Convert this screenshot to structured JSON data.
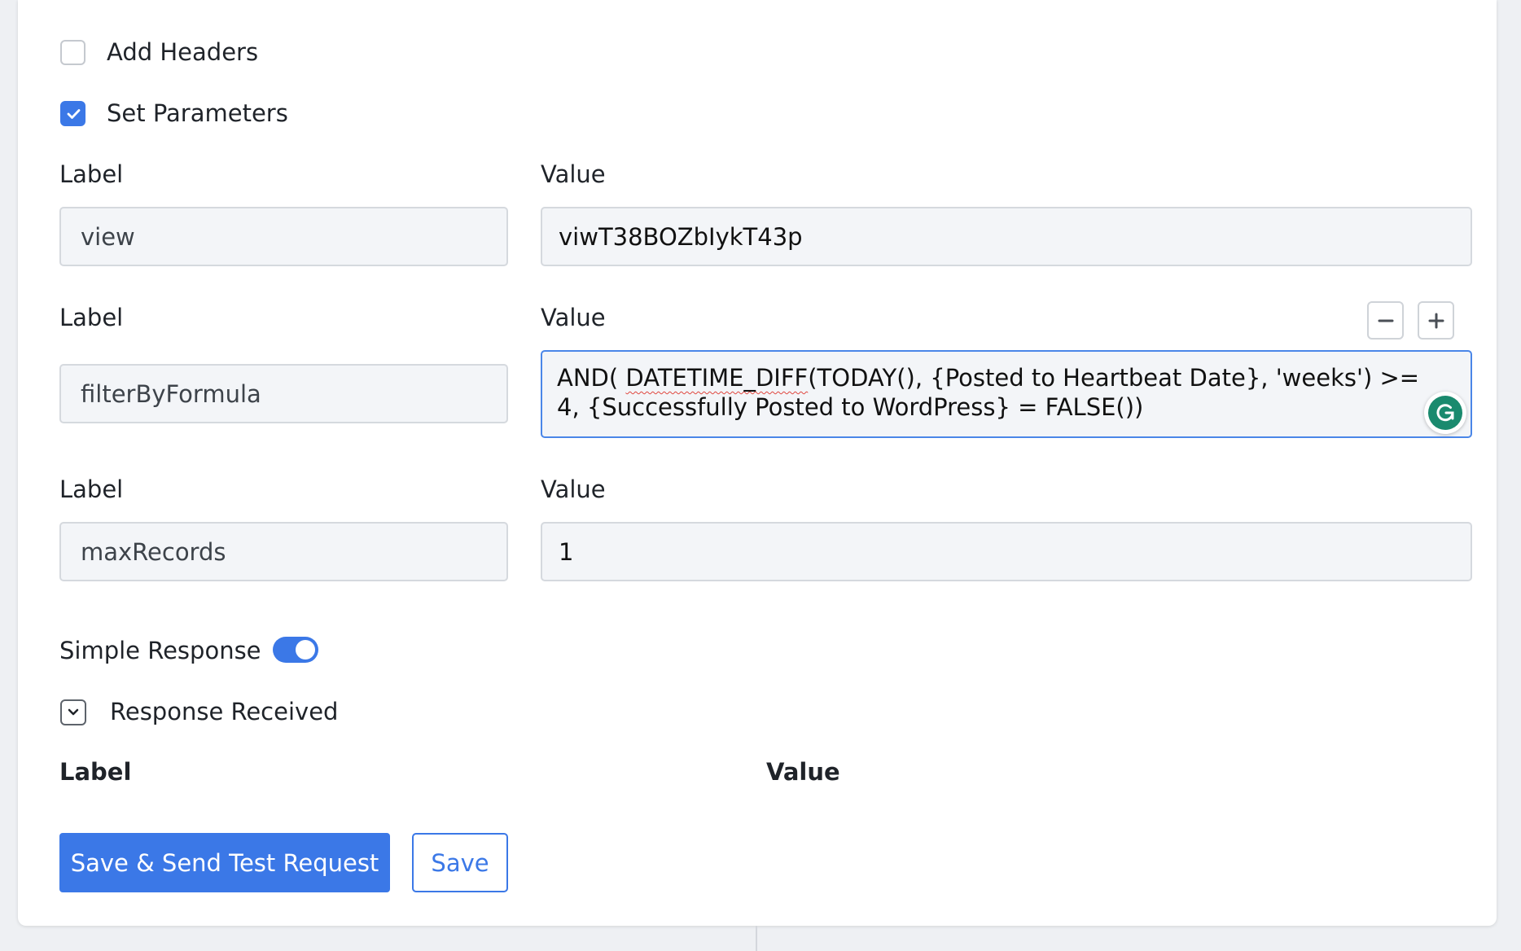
{
  "options": {
    "add_headers": {
      "label": "Add Headers",
      "checked": false
    },
    "set_parameters": {
      "label": "Set Parameters",
      "checked": true
    }
  },
  "params": [
    {
      "label_title": "Label",
      "value_title": "Value",
      "label": "view",
      "value": "viwT38BOZbIykT43p"
    },
    {
      "label_title": "Label",
      "value_title": "Value",
      "label": "filterByFormula",
      "value_part1": "AND( ",
      "value_squiggle": "DATETIME_DIFF",
      "value_part2": "(TODAY(), {Posted to Heartbeat Date}, 'weeks') >=",
      "value_line2": "4, {Successfully Posted to WordPress} = FALSE())"
    },
    {
      "label_title": "Label",
      "value_title": "Value",
      "label": "maxRecords",
      "value": "1"
    }
  ],
  "simple_response": {
    "label": "Simple Response",
    "enabled": true
  },
  "response_received": {
    "label": "Response Received",
    "label_header": "Label",
    "value_header": "Value"
  },
  "buttons": {
    "save_send": "Save & Send Test Request",
    "save": "Save"
  },
  "colors": {
    "accent": "#3b78e7",
    "grammarly": "#1a8a6e"
  }
}
